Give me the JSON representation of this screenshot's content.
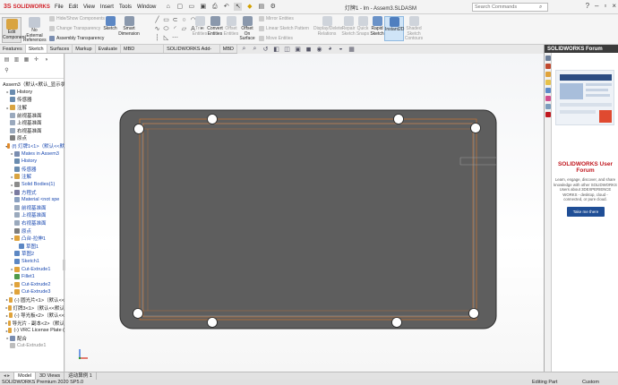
{
  "app": {
    "logo_ds": "3S",
    "logo_text": "SOLIDWORKS",
    "document_title": "灯牌1 - lm - Assem3.SLDASM",
    "search_placeholder": "Search Commands",
    "menu": [
      "File",
      "Edit",
      "View",
      "Insert",
      "Tools",
      "Window"
    ]
  },
  "ribbon": {
    "edit_component": "Edit Component",
    "no_external_references": "No External References",
    "hide_show_components": "Hide/Show Components",
    "change_transparency": "Change Transparency",
    "assembly_transparency": "Assembly Transparency",
    "sketch": "Sketch",
    "smart_dimension": "Smart Dimension",
    "trim_entities": "Trim Entities",
    "convert_entities": "Convert Entities",
    "offset_entities": "Offset Entities",
    "offset_on_surface": "Offset On Surface",
    "mirror_entities": "Mirror Entities",
    "linear_sketch_pattern": "Linear Sketch Pattern",
    "move_entities": "Move Entities",
    "display_delete_relations": "Display/Delete Relations",
    "repair_sketch": "Repair Sketch",
    "quick_snaps": "Quick Snaps",
    "rapid_sketch": "Rapid Sketch",
    "instant2d": "Instant2D",
    "shaded_sketch_contours": "Shaded Sketch Contours"
  },
  "tabs": [
    "Features",
    "Sketch",
    "Surfaces",
    "Markup",
    "Evaluate",
    "MBD Dimensions",
    "SOLIDWORKS Add-Ins",
    "MBD"
  ],
  "active_tab": "Sketch",
  "tree": [
    {
      "label": "Assem3（默认<默认_显示状",
      "indent": 0,
      "expand": "",
      "color": "#8aa0c0"
    },
    {
      "label": "History",
      "indent": 1,
      "expand": "▸",
      "color": "#6a8caf"
    },
    {
      "label": "传感器",
      "indent": 1,
      "expand": "",
      "color": "#6a8caf"
    },
    {
      "label": "注解",
      "indent": 1,
      "expand": "▸",
      "color": "#d9a441"
    },
    {
      "label": "前视基准面",
      "indent": 1,
      "expand": "",
      "color": "#9aa9bd"
    },
    {
      "label": "上视基准面",
      "indent": 1,
      "expand": "",
      "color": "#9aa9bd"
    },
    {
      "label": "右视基准面",
      "indent": 1,
      "expand": "",
      "color": "#9aa9bd"
    },
    {
      "label": "原点",
      "indent": 1,
      "expand": "",
      "color": "#7e7e7e"
    },
    {
      "label": "(f) 灯牌1<1>（默认<<默",
      "indent": 1,
      "expand": "▾",
      "color": "#e08a2b",
      "style": "blue"
    },
    {
      "label": "Mates in Assem3",
      "indent": 2,
      "expand": "▸",
      "color": "#7a8db0",
      "style": "blue"
    },
    {
      "label": "History",
      "indent": 2,
      "expand": "",
      "color": "#6a8caf",
      "style": "blue"
    },
    {
      "label": "传感器",
      "indent": 2,
      "expand": "",
      "color": "#6a8caf",
      "style": "blue"
    },
    {
      "label": "注解",
      "indent": 2,
      "expand": "▸",
      "color": "#d9a441",
      "style": "blue"
    },
    {
      "label": "Solid Bodies(1)",
      "indent": 2,
      "expand": "▸",
      "color": "#8b8b8b",
      "style": "blue"
    },
    {
      "label": "方程式",
      "indent": 2,
      "expand": "▸",
      "color": "#7a7aa0",
      "style": "blue"
    },
    {
      "label": "Material <not spe",
      "indent": 2,
      "expand": "",
      "color": "#8aa0c0",
      "style": "blue"
    },
    {
      "label": "前视基准面",
      "indent": 2,
      "expand": "",
      "color": "#9aa9bd",
      "style": "blue"
    },
    {
      "label": "上视基准面",
      "indent": 2,
      "expand": "",
      "color": "#9aa9bd",
      "style": "blue"
    },
    {
      "label": "右视基准面",
      "indent": 2,
      "expand": "",
      "color": "#9aa9bd",
      "style": "blue"
    },
    {
      "label": "原点",
      "indent": 2,
      "expand": "",
      "color": "#7e7e7e",
      "style": "blue"
    },
    {
      "label": "凸台-拉伸1",
      "indent": 2,
      "expand": "▾",
      "color": "#e0a33b",
      "style": "blue"
    },
    {
      "label": "草图1",
      "indent": 3,
      "expand": "",
      "color": "#5c87c4",
      "style": "blue"
    },
    {
      "label": "草图2",
      "indent": 2,
      "expand": "",
      "color": "#5c87c4",
      "style": "blue"
    },
    {
      "label": "Sketch1",
      "indent": 2,
      "expand": "",
      "color": "#5c87c4",
      "style": "blue"
    },
    {
      "label": "Cut-Extrude1",
      "indent": 2,
      "expand": "▸",
      "color": "#e0a33b",
      "style": "blue"
    },
    {
      "label": "Fillet1",
      "indent": 2,
      "expand": "",
      "color": "#4f9a4a",
      "style": "blue"
    },
    {
      "label": "Cut-Extrude2",
      "indent": 2,
      "expand": "▸",
      "color": "#e0a33b",
      "style": "blue"
    },
    {
      "label": "Cut-Extrude3",
      "indent": 2,
      "expand": "▸",
      "color": "#e0a33b",
      "style": "blue"
    },
    {
      "label": "(-) 圆光片<1>（默认<<",
      "indent": 1,
      "expand": "▸",
      "color": "#e0a33b"
    },
    {
      "label": "灯牌3<1>（默认<<默认",
      "indent": 1,
      "expand": "▸",
      "color": "#e0a33b"
    },
    {
      "label": "(-) 导光板<2>（默认<<",
      "indent": 1,
      "expand": "▸",
      "color": "#e0a33b"
    },
    {
      "label": "导光片 - 副本<2>（默认",
      "indent": 1,
      "expand": "▸",
      "color": "#e0a33b"
    },
    {
      "label": "(-) VRC License Plate (",
      "indent": 1,
      "expand": "▸",
      "color": "#e0a33b"
    },
    {
      "label": "配合",
      "indent": 1,
      "expand": "▸",
      "color": "#7a8db0"
    },
    {
      "label": "Cut-Extrude1",
      "indent": 1,
      "expand": "",
      "color": "#bdbdbd",
      "style": "grey"
    }
  ],
  "bottom_tabs": [
    "Model",
    "3D Views",
    "运动算例 1"
  ],
  "status": {
    "product": "SOLIDWORKS Premium 2020 SP5.0",
    "editing": "Editing Part",
    "custom": "Custom"
  },
  "right_panel": {
    "header": "SOLIDWORKS Forum",
    "title": "SOLIDWORKS User Forum",
    "body": "Learn, engage, discover, and share knowledge with other SOLIDWORKS Users about 3DEXPERIENCE WORKS - desktop, cloud - connected, or pure cloud.",
    "button": "Take me there"
  },
  "colors": {
    "plate": "#5e5e5e",
    "sketch_line": "#e0792b",
    "forum_red": "#c0181f",
    "forum_button": "#1f4e96"
  }
}
